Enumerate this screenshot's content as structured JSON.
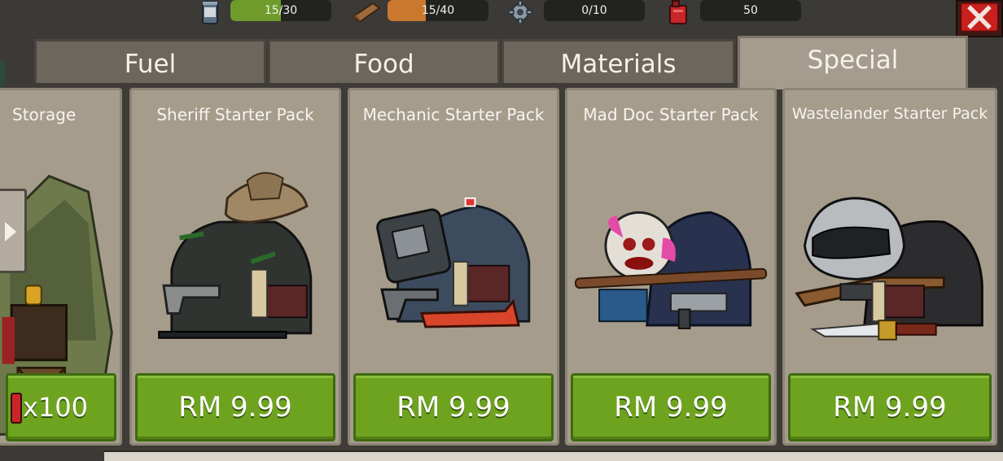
{
  "resources": [
    {
      "icon": "can-icon",
      "text": "15/30",
      "fraction": 0.5,
      "fill_color": "#6e9b2c"
    },
    {
      "icon": "wood-plank-icon",
      "text": "15/40",
      "fraction": 0.375,
      "fill_color": "#c9782d"
    },
    {
      "icon": "gear-icon",
      "text": "0/10",
      "fraction": 0,
      "fill_color": "#8a8a8a"
    },
    {
      "icon": "fuel-canister-icon",
      "text": "50"
    }
  ],
  "close_icon": "close-icon",
  "tabs": [
    {
      "label": "Fuel",
      "active": false
    },
    {
      "label": "Food",
      "active": false
    },
    {
      "label": "Materials",
      "active": false
    },
    {
      "label": "Special",
      "active": true
    }
  ],
  "cards": [
    {
      "title": "Storage",
      "price": "x100",
      "art": "storage-tent-icon"
    },
    {
      "title": "Sheriff Starter Pack",
      "price": "RM 9.99",
      "art": "sheriff-pack-icon"
    },
    {
      "title": "Mechanic Starter Pack",
      "price": "RM 9.99",
      "art": "mechanic-pack-icon"
    },
    {
      "title": "Mad Doc Starter Pack",
      "price": "RM 9.99",
      "art": "mad-doc-pack-icon"
    },
    {
      "title": "Wastelander Starter Pack",
      "price": "RM 9.99",
      "art": "wastelander-pack-icon"
    }
  ],
  "colors": {
    "price_button": "#6ea31f",
    "card_bg": "#a59c8c",
    "close_button": "#c8201c"
  }
}
